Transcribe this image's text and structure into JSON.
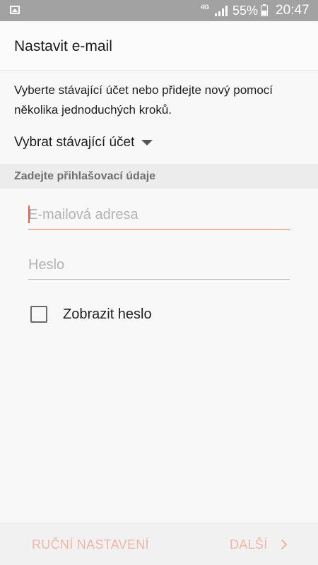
{
  "status_bar": {
    "network": "4G",
    "battery_percent": "55%",
    "time": "20:47",
    "icons": [
      "gallery-icon",
      "signal-icon",
      "battery-icon"
    ]
  },
  "header": {
    "title": "Nastavit e-mail"
  },
  "main": {
    "description": "Vyberte stávající účet nebo přidejte nový pomocí několika jednoduchých kroků.",
    "existing_account_label": "Vybrat stávající účet",
    "section_title": "Zadejte přihlašovací údaje",
    "email": {
      "value": "",
      "placeholder": "E-mailová adresa"
    },
    "password": {
      "value": "",
      "placeholder": "Heslo"
    },
    "show_password": {
      "label": "Zobrazit heslo",
      "checked": false
    }
  },
  "footer": {
    "manual_setup_label": "RUČNÍ NASTAVENÍ",
    "next_label": "DALŠÍ"
  },
  "colors": {
    "status_bar": "#a2a2a2",
    "accent": "#e07a63",
    "disabled_action": "#efb6aa",
    "section_bg": "#ececec"
  }
}
